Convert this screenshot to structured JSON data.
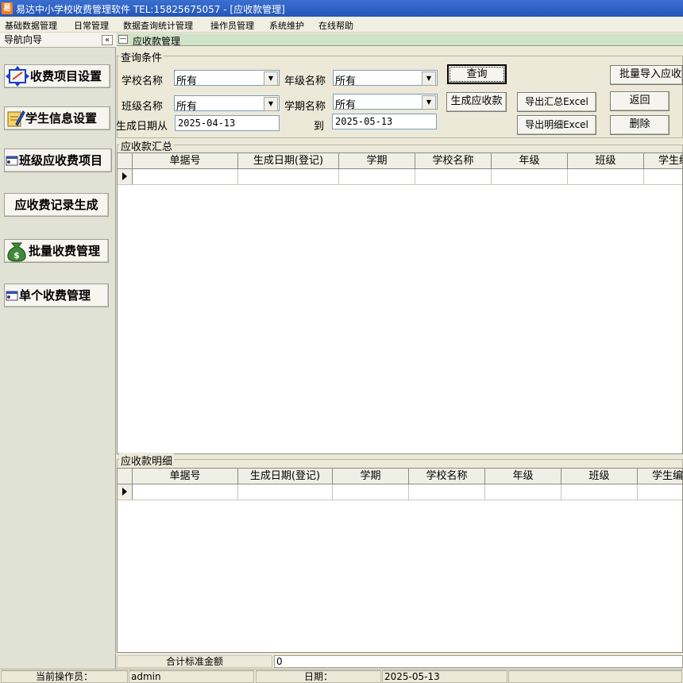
{
  "window": {
    "icon_char": "易",
    "title": "易达中小学校收费管理软件  TEL:15825675057  - [应收款管理]"
  },
  "menu": [
    "基础数据管理",
    "日常管理",
    "数据查询统计管理",
    "操作员管理",
    "系统维护",
    "在线帮助"
  ],
  "nav": {
    "title": "导航向导",
    "collapse": "«",
    "items": [
      "收费项目设置",
      "学生信息设置",
      "班级应收费项目",
      "应收费记录生成",
      "批量收费管理",
      "单个收费管理"
    ]
  },
  "tab": {
    "title": "应收款管理"
  },
  "query": {
    "legend": "查询条件",
    "school_label": "学校名称",
    "school_value": "所有",
    "grade_label": "年级名称",
    "grade_value": "所有",
    "class_label": "班级名称",
    "class_value": "所有",
    "term_label": "学期名称",
    "term_value": "所有",
    "date_from_label": "生成日期从",
    "date_from": "2025-04-13",
    "date_to_label": "到",
    "date_to": "2025-05-13"
  },
  "buttons": {
    "query": "查询",
    "generate": "生成应收款",
    "export_summary": "导出汇总Excel",
    "export_detail": "导出明细Excel",
    "batch_import": "批量导入应收",
    "back": "返回",
    "delete": "删除"
  },
  "summary": {
    "legend": "应收款汇总",
    "columns": [
      "单据号",
      "生成日期(登记)",
      "学期",
      "学校名称",
      "年级",
      "班级",
      "学生编"
    ]
  },
  "detail": {
    "legend": "应收款明细",
    "columns": [
      "单据号",
      "生成日期(登记)",
      "学期",
      "学校名称",
      "年级",
      "班级",
      "学生编"
    ]
  },
  "footer": {
    "total_label": "合计标准金额",
    "total_value": "0"
  },
  "status": {
    "operator_label": "当前操作员：",
    "operator": "admin",
    "date_label": "日期：",
    "date": "2025-05-13"
  }
}
